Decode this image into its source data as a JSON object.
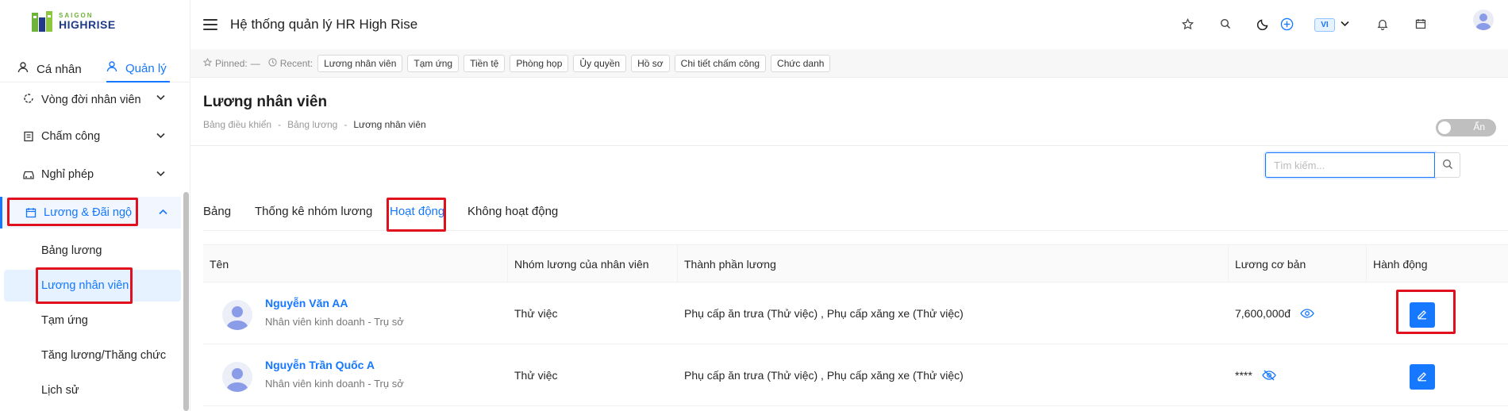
{
  "brand": {
    "small": "SAIGON",
    "big": "HIGHRISE"
  },
  "side_tabs": {
    "personal": "Cá nhân",
    "manage": "Quản lý"
  },
  "menu": {
    "lifecycle": "Vòng đời nhân viên",
    "attendance": "Chấm công",
    "leave": "Nghỉ phép",
    "payroll": "Lương & Đãi ngộ"
  },
  "submenu": {
    "salary_table": "Bảng lương",
    "employee_salary": "Lương nhân viên",
    "advance": "Tạm ứng",
    "raise": "Tăng lương/Thăng chức",
    "history": "Lịch sử"
  },
  "header": {
    "title": "Hệ thống quản lý HR High Rise",
    "lang": "VI"
  },
  "pinbar": {
    "pinned_label": "Pinned:",
    "pinned_value": "—",
    "recent_label": "Recent:",
    "recent": [
      "Lương nhân viên",
      "Tạm ứng",
      "Tiền tệ",
      "Phòng họp",
      "Ủy quyền",
      "Hồ sơ",
      "Chi tiết chấm công",
      "Chức danh"
    ]
  },
  "page": {
    "title": "Lương nhân viên",
    "breadcrumb": [
      "Bảng điều khiển",
      "Bảng lương",
      "Lương nhân viên"
    ],
    "breadcrumb_sep": "-",
    "toggle_label": "Ẩn"
  },
  "search": {
    "placeholder": "Tìm kiếm..."
  },
  "tabs": [
    "Bảng",
    "Thống kê nhóm lương",
    "Hoạt động",
    "Không hoạt động"
  ],
  "table": {
    "headers": [
      "Tên",
      "Nhóm lương của nhân viên",
      "Thành phần lương",
      "Lương cơ bản",
      "Hành động"
    ],
    "rows": [
      {
        "name": "Nguyễn Văn AA",
        "role": "Nhân viên kinh doanh - Trụ sở",
        "group": "Thử việc",
        "components": "Phụ cấp ăn trưa (Thử việc) , Phụ cấp xăng xe (Thử việc)",
        "base_salary": "7,600,000đ",
        "visibility_icon": "eye-icon"
      },
      {
        "name": "Nguyễn Trần Quốc A",
        "role": "Nhân viên kinh doanh - Trụ sở",
        "group": "Thử việc",
        "components": "Phụ cấp ăn trưa (Thử việc) , Phụ cấp xăng xe (Thử việc)",
        "base_salary": "****",
        "visibility_icon": "eye-off-icon"
      }
    ]
  },
  "colors": {
    "accent": "#1677ff",
    "highlight": "#e0101f",
    "brand_green": "#6fb33a",
    "brand_navy": "#1f3b8a"
  }
}
